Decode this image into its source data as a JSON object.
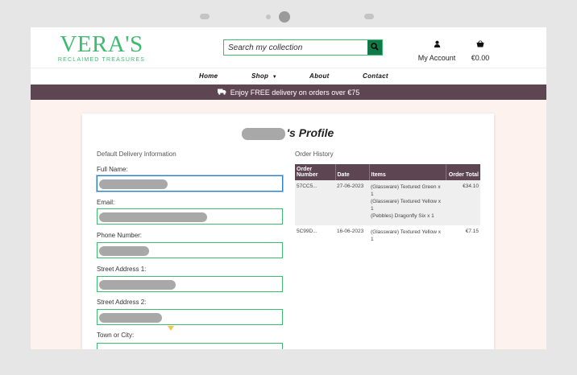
{
  "header": {
    "logo_title": "VERA'S",
    "logo_subtitle": "RECLAIMED TREASURES",
    "search_placeholder": "Search my collection",
    "account_label": "My Account",
    "cart_total": "€0.00"
  },
  "nav": {
    "items": [
      "Home",
      "Shop",
      "About",
      "Contact"
    ]
  },
  "banner": {
    "text": "Enjoy FREE delivery on orders over €75"
  },
  "profile": {
    "title_suffix": "'s Profile",
    "delivery_heading": "Default Delivery Information",
    "fields": [
      {
        "label": "Full Name:"
      },
      {
        "label": "Email:"
      },
      {
        "label": "Phone Number:"
      },
      {
        "label": "Street Address 1:"
      },
      {
        "label": "Street Address 2:"
      },
      {
        "label": "Town or City:"
      }
    ]
  },
  "orders": {
    "heading": "Order History",
    "columns": [
      "Order Number",
      "Date",
      "Items",
      "Order Total"
    ],
    "rows": [
      {
        "number": "57CC5...",
        "date": "27-06-2023",
        "items": [
          "(Glassware) Textured Green x 1",
          "(Glassware) Textured Yellow x 1",
          "(Pebbles) Dragonfly Six x 1"
        ],
        "total": "€34.10"
      },
      {
        "number": "5C99D...",
        "date": "16-06-2023",
        "items": [
          "(Glassware) Textured Yellow x 1"
        ],
        "total": "€7.15"
      }
    ]
  },
  "colors": {
    "brand_green": "#3dbb70",
    "search_button": "#0f7a47",
    "plum": "#5e4552",
    "page_background": "#fdf2ee"
  }
}
